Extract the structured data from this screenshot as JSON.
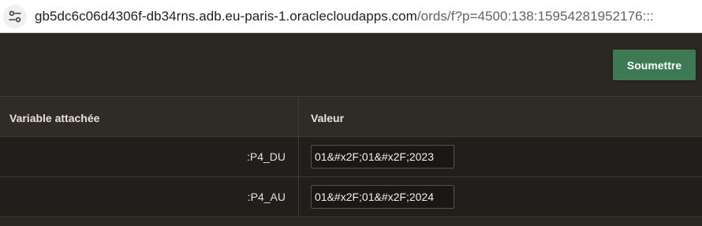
{
  "browser": {
    "url_host": "gb5dc6c06d4306f-db34rns.adb.eu-paris-1.oraclecloudapps.com",
    "url_path": "/ords/f?p=4500:138:15954281952176:::"
  },
  "toolbar": {
    "submit_label": "Soumettre"
  },
  "bind_table": {
    "headers": {
      "variable": "Variable attachée",
      "value": "Valeur"
    },
    "rows": [
      {
        "variable": ":P4_DU",
        "value": "01&#x2F;01&#x2F;2023"
      },
      {
        "variable": ":P4_AU",
        "value": "01&#x2F;01&#x2F;2024"
      }
    ]
  },
  "colors": {
    "submit_button": "#3d7a53",
    "background": "#211e1b"
  },
  "icons": {
    "site_info": "site-info-tune-icon"
  }
}
